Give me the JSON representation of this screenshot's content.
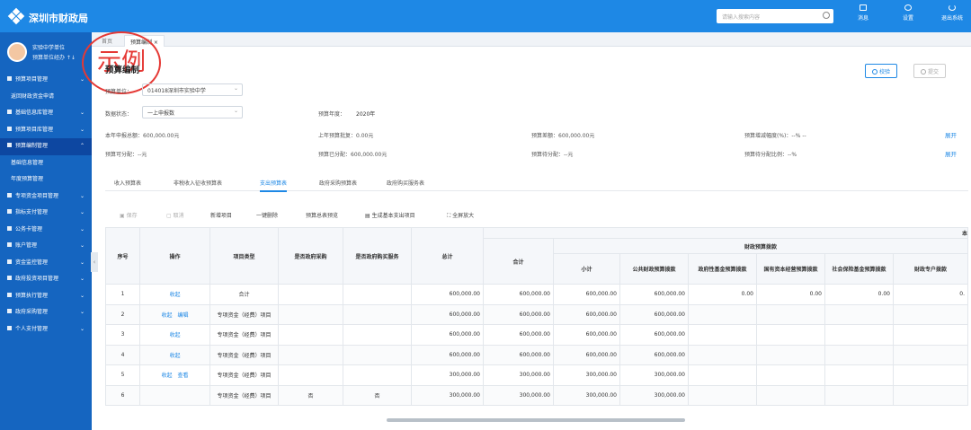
{
  "app": {
    "title": "深圳市财政局"
  },
  "search": {
    "placeholder": "请输入搜索内容"
  },
  "top_icons": [
    {
      "icon": "message-icon",
      "label": "消息"
    },
    {
      "icon": "settings-icon",
      "label": "设置"
    },
    {
      "icon": "power-icon",
      "label": "退出系统"
    }
  ],
  "user": {
    "name": "实验中学单位",
    "role": "预算单位经办 ↑↓"
  },
  "sidebar": {
    "items": [
      {
        "label": "预算项目管理",
        "icon": "list-icon",
        "chev": "⌄",
        "active": false,
        "sub": false
      },
      {
        "label": "返回财政资金申请",
        "icon": "",
        "chev": "",
        "active": false,
        "sub": true
      },
      {
        "label": "基础信息库管理",
        "icon": "database-icon",
        "chev": "⌄",
        "active": false,
        "sub": false
      },
      {
        "label": "预算项目库管理",
        "icon": "folder-icon",
        "chev": "⌄",
        "active": false,
        "sub": false
      },
      {
        "label": "预算编制管理",
        "icon": "edit-icon",
        "chev": "⌃",
        "active": true,
        "sub": false
      },
      {
        "label": "基础信息管理",
        "icon": "",
        "chev": "",
        "active": false,
        "sub": true
      },
      {
        "label": "年度预算管理",
        "icon": "",
        "chev": "",
        "active": false,
        "sub": true
      },
      {
        "label": "专项资金项目管理",
        "icon": "grid-icon",
        "chev": "⌄",
        "active": false,
        "sub": false
      },
      {
        "label": "指标支付管理",
        "icon": "pin-icon",
        "chev": "⌄",
        "active": false,
        "sub": false
      },
      {
        "label": "公务卡管理",
        "icon": "card-icon",
        "chev": "⌄",
        "active": false,
        "sub": false
      },
      {
        "label": "账户管理",
        "icon": "account-icon",
        "chev": "⌄",
        "active": false,
        "sub": false
      },
      {
        "label": "资金监控管理",
        "icon": "monitor-icon",
        "chev": "⌄",
        "active": false,
        "sub": false
      },
      {
        "label": "政府投资项目管理",
        "icon": "building-icon",
        "chev": "⌄",
        "active": false,
        "sub": false
      },
      {
        "label": "预算执行管理",
        "icon": "chart-icon",
        "chev": "⌄",
        "active": false,
        "sub": false
      },
      {
        "label": "政府采购管理",
        "icon": "cart-icon",
        "chev": "⌄",
        "active": false,
        "sub": false
      },
      {
        "label": "个人支付管理",
        "icon": "person-icon",
        "chev": "⌄",
        "active": false,
        "sub": false
      }
    ]
  },
  "tabs": [
    {
      "label": "首页"
    },
    {
      "label": "预算编制 ×"
    }
  ],
  "stamp": "示例",
  "page": {
    "title": "预算编制",
    "check_button": "校验",
    "submit_button": "提交",
    "unit_label": "预算单位：",
    "unit_value": "014018深圳市实验中学",
    "status_label": "数据状态：",
    "status_value": "一上申报数",
    "year_label": "预算年度：",
    "year_value": "2020年",
    "summary_row1": [
      "本年申报总额：600,000.00元",
      "上年预算批复：0.00元",
      "预算差额：600,000.00元",
      "预算增减幅度(%)：--% --"
    ],
    "summary_row2": [
      "预算可分配：--元",
      "预算已分配：600,000.00元",
      "预算待分配：--元",
      "预算待分配比例：--%"
    ],
    "expand_label": "展开"
  },
  "subtabs": [
    "收入预算表",
    "非税收入征收预算表",
    "支出预算表",
    "政府采购预算表",
    "政府购买服务表"
  ],
  "toolbar": [
    "保存",
    "取消",
    "新增项目",
    "一键删除",
    "预算总表预览",
    "生成基本支出项目",
    "全屏放大"
  ],
  "table": {
    "headers": {
      "seq": "序号",
      "op": "操作",
      "type": "项目类型",
      "gov_proc": "是否政府采购",
      "gov_service": "是否政府购买服务",
      "total": "总计",
      "sum": "合计",
      "fiscal_group": "财政预算拨款",
      "subtotal": "小计",
      "public": "公共财政预算拨款",
      "fund": "政府性基金预算拨款",
      "state_capital": "国有资本经营预算拨款",
      "social": "社会保险基金预算拨款",
      "special": "财政专户拨款",
      "right_corner": "本"
    },
    "rows": [
      {
        "seq": "1",
        "ops": [
          "收起"
        ],
        "type": "合计",
        "gp": "",
        "gs": "",
        "total": "600,000.00",
        "sum": "600,000.00",
        "subtotal": "600,000.00",
        "public": "600,000.00",
        "fund": "0.00",
        "state": "0.00",
        "social": "0.00",
        "special": "0."
      },
      {
        "seq": "2",
        "ops": [
          "收起",
          "编辑"
        ],
        "type": "专项资金（经费）项目",
        "gp": "",
        "gs": "",
        "total": "600,000.00",
        "sum": "600,000.00",
        "subtotal": "600,000.00",
        "public": "600,000.00",
        "fund": "",
        "state": "",
        "social": "",
        "special": ""
      },
      {
        "seq": "3",
        "ops": [
          "收起"
        ],
        "type": "专项资金（经费）项目",
        "gp": "",
        "gs": "",
        "total": "600,000.00",
        "sum": "600,000.00",
        "subtotal": "600,000.00",
        "public": "600,000.00",
        "fund": "",
        "state": "",
        "social": "",
        "special": ""
      },
      {
        "seq": "4",
        "ops": [
          "收起"
        ],
        "type": "专项资金（经费）项目",
        "gp": "",
        "gs": "",
        "total": "600,000.00",
        "sum": "600,000.00",
        "subtotal": "600,000.00",
        "public": "600,000.00",
        "fund": "",
        "state": "",
        "social": "",
        "special": ""
      },
      {
        "seq": "5",
        "ops": [
          "收起",
          "查看"
        ],
        "type": "专项资金（经费）项目",
        "gp": "",
        "gs": "",
        "total": "300,000.00",
        "sum": "300,000.00",
        "subtotal": "300,000.00",
        "public": "300,000.00",
        "fund": "",
        "state": "",
        "social": "",
        "special": ""
      },
      {
        "seq": "6",
        "ops": [],
        "type": "专项资金（经费）项目",
        "gp": "否",
        "gs": "否",
        "total": "300,000.00",
        "sum": "300,000.00",
        "subtotal": "300,000.00",
        "public": "300,000.00",
        "fund": "",
        "state": "",
        "social": "",
        "special": ""
      }
    ]
  },
  "colors": {
    "primary": "#1e88e5",
    "sidebar": "#1565c0",
    "stamp": "#e53935"
  }
}
